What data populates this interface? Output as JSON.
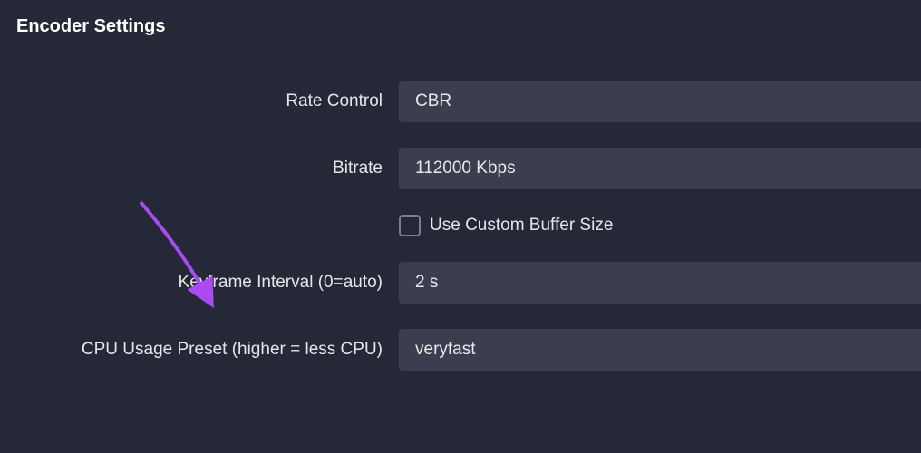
{
  "section": {
    "title": "Encoder Settings"
  },
  "fields": {
    "rateControl": {
      "label": "Rate Control",
      "value": "CBR"
    },
    "bitrate": {
      "label": "Bitrate",
      "value": "112000 Kbps"
    },
    "customBuffer": {
      "label": "Use Custom Buffer Size",
      "checked": false
    },
    "keyframe": {
      "label": "Keyframe Interval (0=auto)",
      "value": "2 s"
    },
    "cpuPreset": {
      "label": "CPU Usage Preset (higher = less CPU)",
      "value": "veryfast"
    }
  },
  "annotation": {
    "arrowColor": "#a84bf0"
  }
}
